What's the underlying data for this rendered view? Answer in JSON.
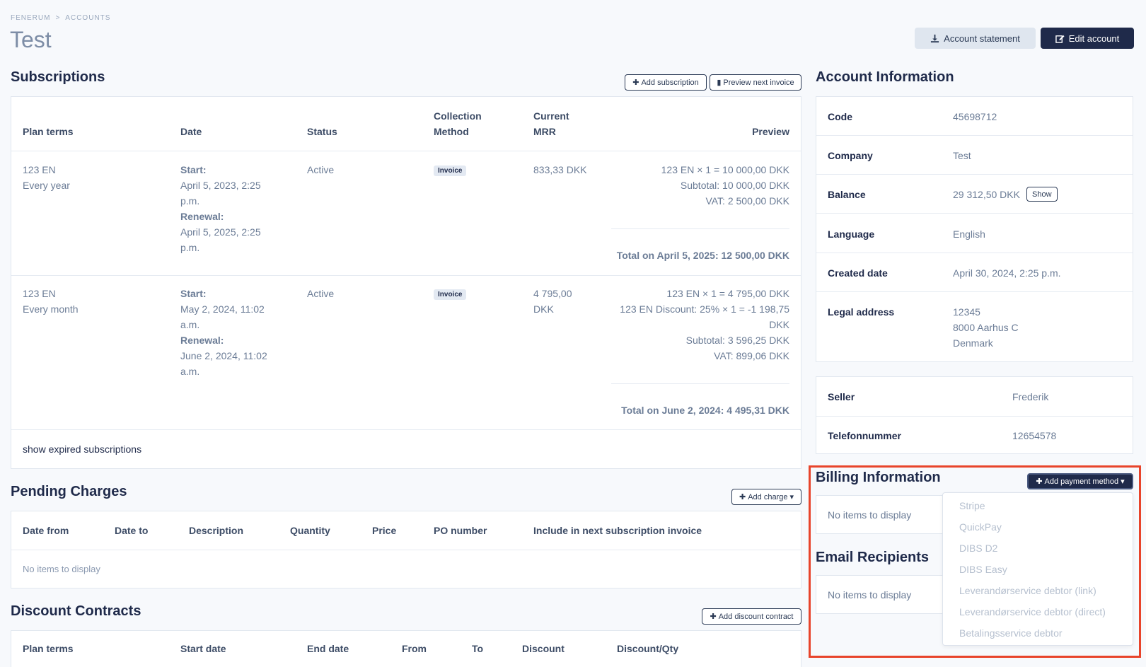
{
  "breadcrumb": {
    "root": "FENERUM",
    "sep": ">",
    "current": "ACCOUNTS"
  },
  "page_title": "Test",
  "header": {
    "statement_label": "Account statement",
    "edit_label": "Edit account"
  },
  "subscriptions": {
    "title": "Subscriptions",
    "add_label": "Add subscription",
    "preview_label": "Preview next invoice",
    "columns": {
      "plan": "Plan terms",
      "date": "Date",
      "status": "Status",
      "method1": "Collection",
      "method2": "Method",
      "mrr1": "Current",
      "mrr2": "MRR",
      "preview": "Preview"
    },
    "rows": [
      {
        "plan": "123 EN",
        "period": "Every year",
        "start_label": "Start:",
        "start1": "April 5, 2023, 2:25",
        "start2": "p.m.",
        "renew_label": "Renewal:",
        "renew1": "April 5, 2025, 2:25",
        "renew2": "p.m.",
        "status": "Active",
        "method": "Invoice",
        "mrr1": "833,33 DKK",
        "mrr2": "",
        "p1": "123 EN × 1 = 10 000,00 DKK",
        "p2": "Subtotal: 10 000,00 DKK",
        "p3": "VAT: 2 500,00 DKK",
        "total": "Total on April 5, 2025: 12 500,00 DKK"
      },
      {
        "plan": "123 EN",
        "period": "Every month",
        "start_label": "Start:",
        "start1": "May 2, 2024, 11:02",
        "start2": "a.m.",
        "renew_label": "Renewal:",
        "renew1": "June 2, 2024, 11:02",
        "renew2": "a.m.",
        "status": "Active",
        "method": "Invoice",
        "mrr1": "4 795,00",
        "mrr2": "DKK",
        "p1": "123 EN × 1 = 4 795,00 DKK",
        "p2": "123 EN Discount: 25% × 1 = -1 198,75",
        "p2b": "DKK",
        "p3": "Subtotal: 3 596,25 DKK",
        "p4": "VAT: 899,06 DKK",
        "total": "Total on June 2, 2024: 4 495,31 DKK"
      }
    ],
    "show_expired": "show expired subscriptions"
  },
  "pending": {
    "title": "Pending Charges",
    "add_label": "Add charge",
    "columns": [
      "Date from",
      "Date to",
      "Description",
      "Quantity",
      "Price",
      "PO number",
      "Include in next subscription invoice"
    ],
    "empty": "No items to display"
  },
  "discounts": {
    "title": "Discount Contracts",
    "add_label": "Add discount contract",
    "columns": [
      "Plan terms",
      "Start date",
      "End date",
      "From",
      "To",
      "Discount",
      "Discount/Qty"
    ]
  },
  "account_info": {
    "title": "Account Information",
    "code_label": "Code",
    "code": "45698712",
    "company_label": "Company",
    "company": "Test",
    "balance_label": "Balance",
    "balance": "29 312,50 DKK",
    "show_label": "Show",
    "language_label": "Language",
    "language": "English",
    "created_label": "Created date",
    "created": "April 30, 2024, 2:25 p.m.",
    "address_label": "Legal address",
    "address1": "12345",
    "address2": "8000 Aarhus C",
    "address3": "Denmark"
  },
  "seller_info": {
    "seller_label": "Seller",
    "seller": "Frederik",
    "phone_label": "Telefonnummer",
    "phone": "12654578"
  },
  "billing": {
    "title": "Billing Information",
    "add_label": "Add payment method",
    "empty": "No items to display"
  },
  "email": {
    "title": "Email Recipients",
    "empty": "No items to display"
  },
  "payment_methods": [
    "Stripe",
    "QuickPay",
    "DIBS D2",
    "DIBS Easy",
    "Leverandørservice debtor (link)",
    "Leverandørservice debtor (direct)",
    "Betalingsservice debtor"
  ],
  "colors": {
    "accent": "#1f2a4a",
    "highlight": "#e8442b"
  }
}
